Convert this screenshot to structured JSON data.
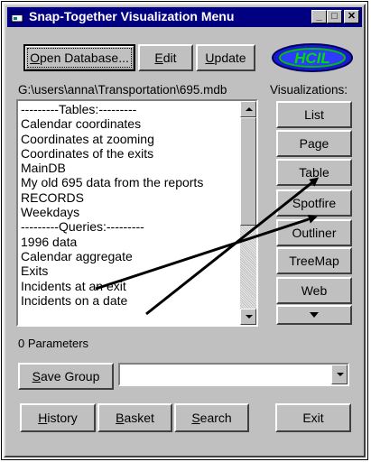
{
  "window": {
    "title": "Snap-Together Visualization Menu",
    "controls": {
      "minimize": "_",
      "maximize": "□",
      "close": "✕"
    }
  },
  "toolbar": {
    "open_database_label": "Open Database...",
    "edit_label": "Edit",
    "update_label": "Update",
    "logo_text": "HCIL"
  },
  "database_path": "G:\\users\\anna\\Transportation\\695.mdb",
  "visualizations_heading": "Visualizations:",
  "list_items": [
    "---------Tables:---------",
    "Calendar coordinates",
    "Coordinates at zooming",
    "Coordinates of the exits",
    "MainDB",
    "My old 695 data from the reports",
    "RECORDS",
    "Weekdays",
    "---------Queries:---------",
    "1996 data",
    "Calendar aggregate",
    "Exits",
    "Incidents at an exit",
    "Incidents on a date"
  ],
  "visualization_buttons": [
    "List",
    "Page",
    "Table",
    "Spotfire",
    "Outliner",
    "TreeMap",
    "Web"
  ],
  "parameters_text": "0 Parameters",
  "save_group_label": "Save Group",
  "group_combo_value": "",
  "bottom_buttons": {
    "history": "History",
    "basket": "Basket",
    "search": "Search",
    "exit": "Exit"
  },
  "icons": {
    "app": "app-window-icon",
    "scroll_more": "chevron-down-icon"
  },
  "colors": {
    "titlebar": "#000080",
    "face": "#c0c0c0",
    "logo_fill": "#1a1ad0"
  }
}
